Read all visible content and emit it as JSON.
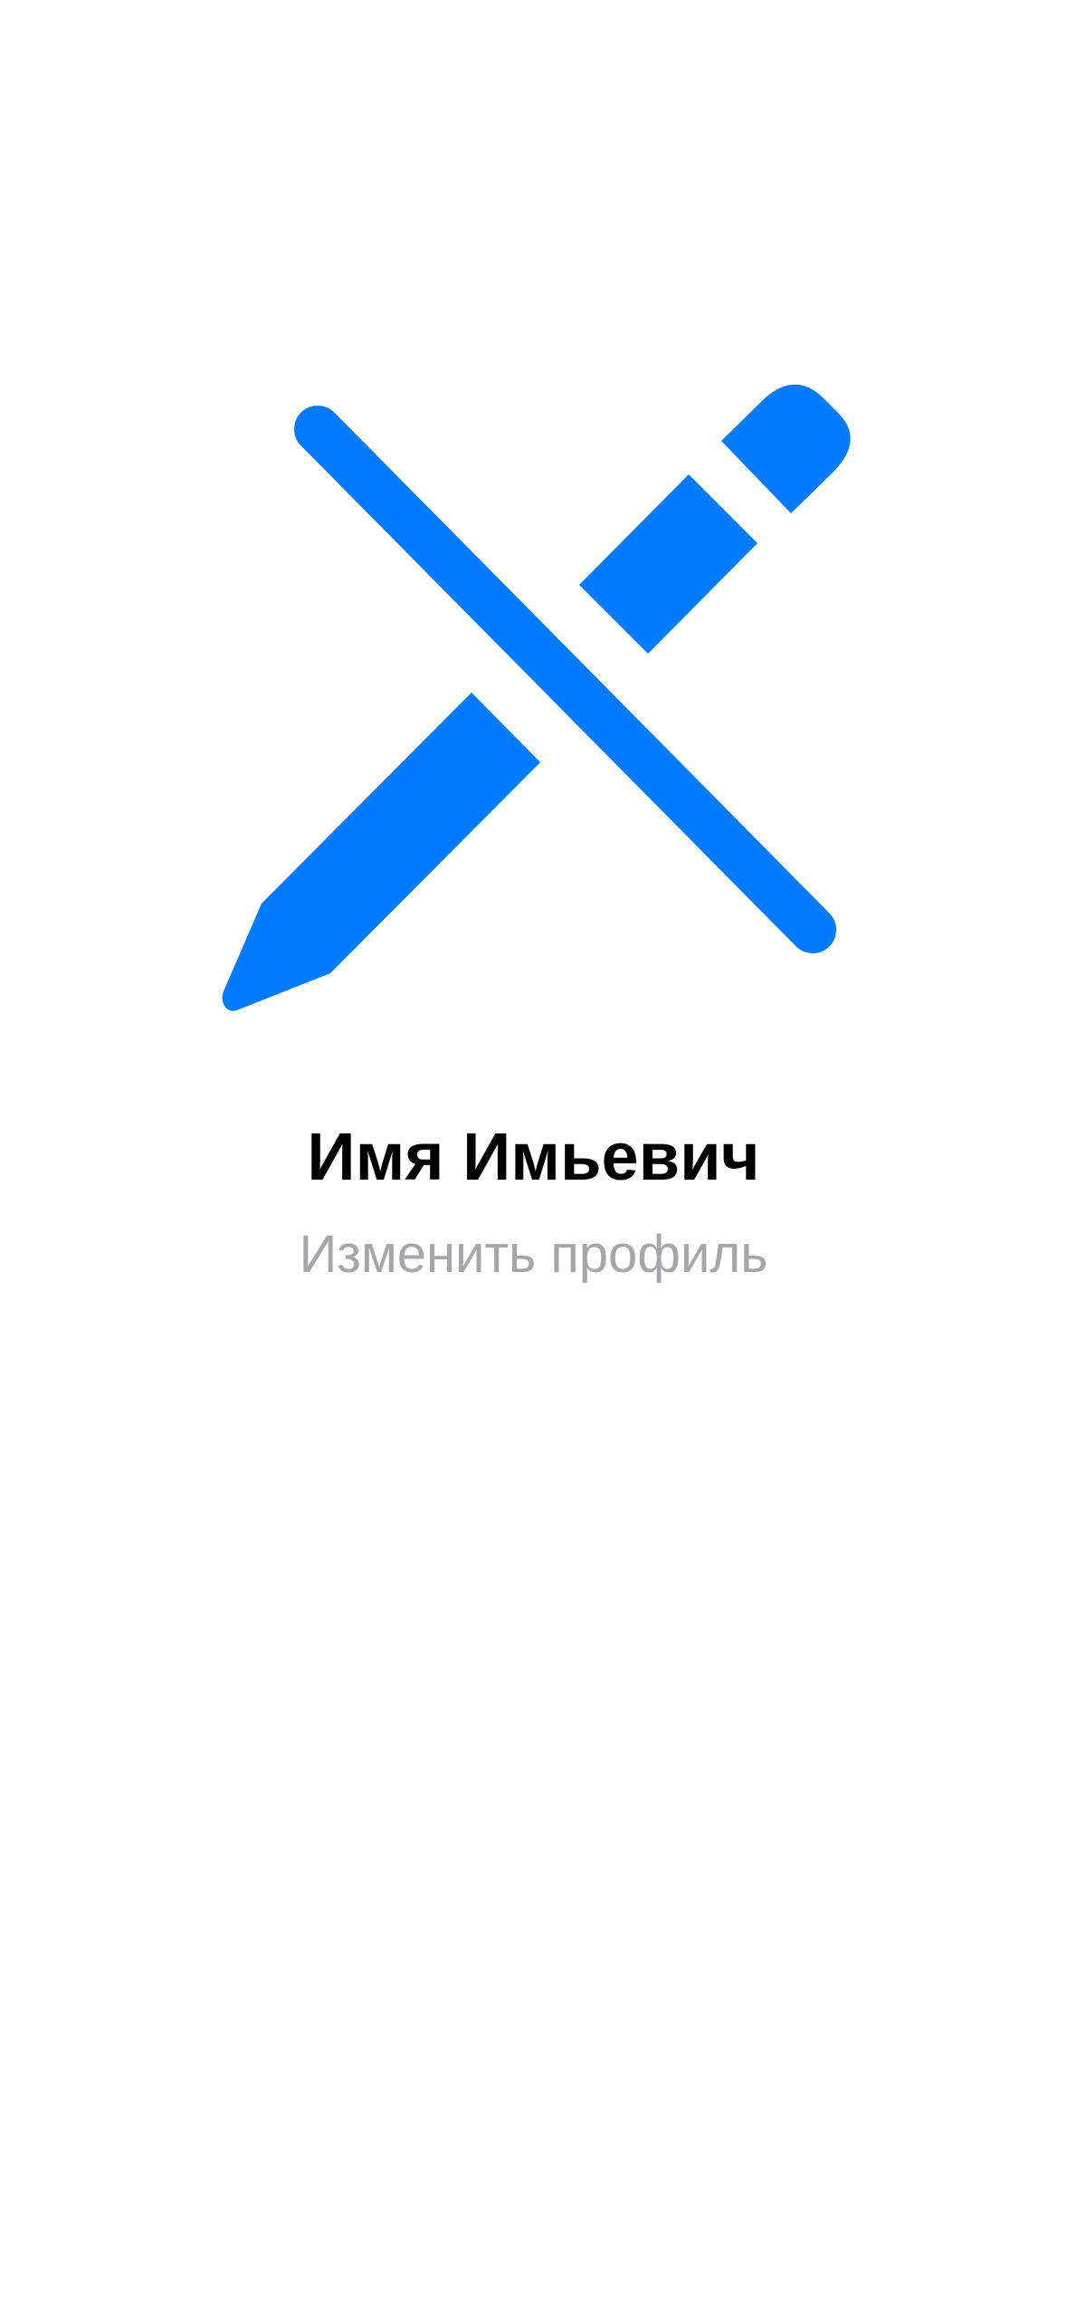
{
  "profile": {
    "icon": "pencil-slash-icon",
    "name": "Имя Имьевич",
    "edit_label": "Изменить профиль"
  },
  "colors": {
    "accent": "#007AFF",
    "name_text": "#000000",
    "secondary_text": "#A6A6AA",
    "background": "#FFFFFF"
  }
}
